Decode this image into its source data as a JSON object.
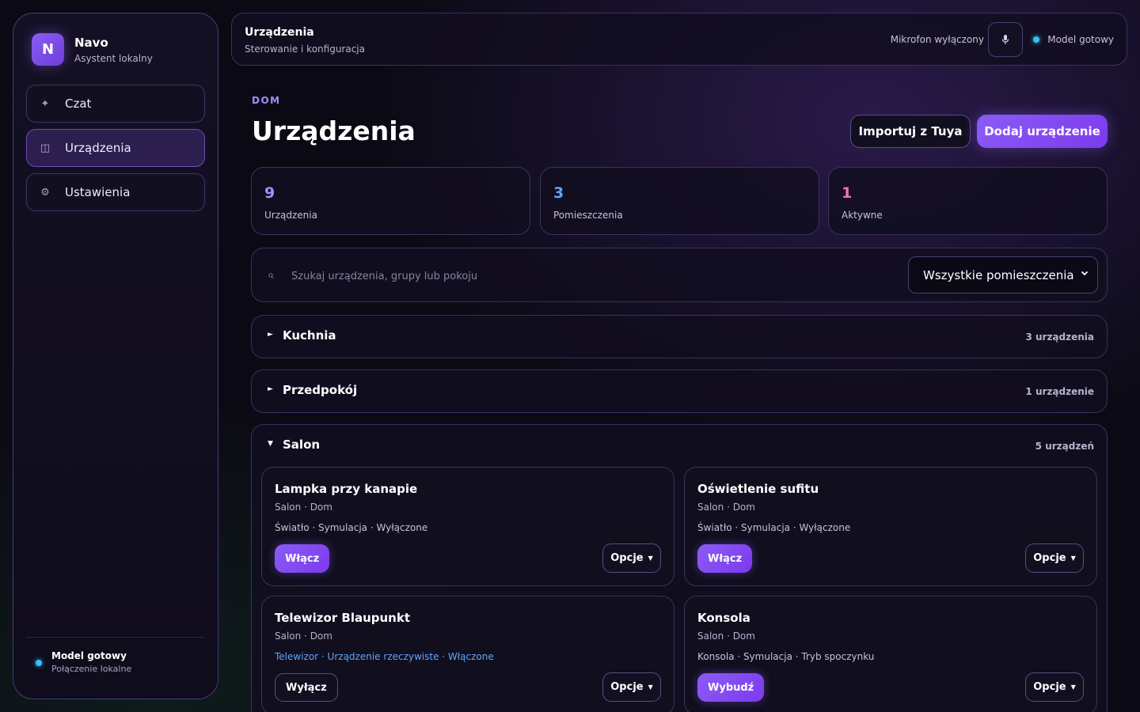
{
  "sidebar": {
    "brand": {
      "logo": "N",
      "name": "Navo",
      "subtitle": "Asystent lokalny"
    },
    "items": [
      {
        "label": "Czat",
        "icon": "sparkle-icon",
        "glyph": "✦",
        "active": false
      },
      {
        "label": "Urządzenia",
        "icon": "devices-icon",
        "glyph": "◫",
        "active": true
      },
      {
        "label": "Ustawienia",
        "icon": "gear-icon",
        "glyph": "⚙",
        "active": false
      }
    ],
    "status": {
      "title": "Model gotowy",
      "subtitle": "Połączenie lokalne"
    }
  },
  "topbar": {
    "title": "Urządzenia",
    "subtitle": "Sterowanie i konfiguracja",
    "mic_label": "Mikrofon wyłączony",
    "mic_icon": "microphone-icon",
    "model_label": "Model gotowy"
  },
  "page": {
    "eyebrow": "DOM",
    "title": "Urządzenia",
    "import_label": "Importuj z Tuya",
    "add_label": "Dodaj urządzenie"
  },
  "stats": [
    {
      "value": "9",
      "label": "Urządzenia",
      "color": "#a78bfa"
    },
    {
      "value": "3",
      "label": "Pomieszczenia",
      "color": "#60a5fa"
    },
    {
      "value": "1",
      "label": "Aktywne",
      "color": "#f472b6"
    }
  ],
  "search": {
    "placeholder": "Szukaj urządzenia, grupy lub pokoju",
    "room_filter": "Wszystkie pomieszczenia"
  },
  "groups": [
    {
      "name": "Kuchnia",
      "count": "3 urządzenia",
      "expanded": false,
      "arrow": "►"
    },
    {
      "name": "Przedpokój",
      "count": "1 urządzenie",
      "expanded": false,
      "arrow": "►"
    },
    {
      "name": "Salon",
      "count": "5 urządzeń",
      "expanded": true,
      "arrow": "▼"
    }
  ],
  "devices": [
    {
      "name": "Lampka przy kanapie",
      "location": "Salon · Dom",
      "meta": "Światło · Symulacja · Wyłączone",
      "real": false,
      "toggle": "Włącz",
      "toggle_style": "primary",
      "options": "Opcje"
    },
    {
      "name": "Oświetlenie sufitu",
      "location": "Salon · Dom",
      "meta": "Światło · Symulacja · Wyłączone",
      "real": false,
      "toggle": "Włącz",
      "toggle_style": "primary",
      "options": "Opcje"
    },
    {
      "name": "Telewizor Blaupunkt",
      "location": "Salon · Dom",
      "meta": "Telewizor · Urządzenie rzeczywiste · Włączone",
      "real": true,
      "toggle": "Wyłącz",
      "toggle_style": "ghost",
      "options": "Opcje"
    },
    {
      "name": "Konsola",
      "location": "Salon · Dom",
      "meta": "Konsola · Symulacja · Tryb spoczynku",
      "real": false,
      "toggle": "Wybudź",
      "toggle_style": "primary",
      "options": "Opcje"
    }
  ]
}
